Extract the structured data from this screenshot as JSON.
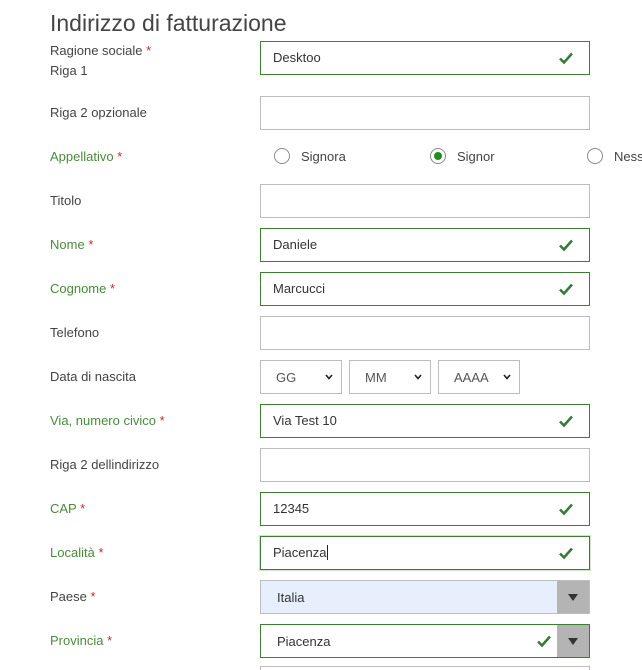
{
  "form": {
    "title": "Indirizzo di fatturazione",
    "required_mark": "*",
    "company": {
      "label": "Ragione sociale",
      "sublabel": "Riga 1",
      "value": "Desktoo"
    },
    "line2_optional": {
      "label": "Riga 2 opzionale",
      "value": ""
    },
    "salutation": {
      "label": "Appellativo",
      "options": [
        {
          "label": "Signora",
          "selected": false
        },
        {
          "label": "Signor",
          "selected": true
        },
        {
          "label": "Nessuno",
          "selected": false
        }
      ]
    },
    "title_field": {
      "label": "Titolo",
      "value": ""
    },
    "first_name": {
      "label": "Nome",
      "value": "Daniele"
    },
    "last_name": {
      "label": "Cognome",
      "value": "Marcucci"
    },
    "phone": {
      "label": "Telefono",
      "value": ""
    },
    "birthdate": {
      "label": "Data di nascita",
      "day": "GG",
      "month": "MM",
      "year": "AAAA"
    },
    "street": {
      "label": "Via, numero civico",
      "value": "Via Test 10"
    },
    "address_line2": {
      "label": "Riga 2 dellindirizzo",
      "value": ""
    },
    "zip": {
      "label": "CAP",
      "value": "12345"
    },
    "city": {
      "label": "Località",
      "value": "Piacenza"
    },
    "country": {
      "label": "Paese",
      "value": "Italia"
    },
    "province": {
      "label": "Provincia",
      "value": "Piacenza"
    }
  },
  "colors": {
    "valid_border": "#3c7f33",
    "valid_label": "#4a8a3c",
    "required_asterisk": "#cc2b2b",
    "checkmark": "#3a7a3a",
    "radio_selected": "#1e8f1e",
    "country_select_bg": "#e8effc",
    "dropdown_button": "#b4b4b4"
  },
  "icons": {
    "valid": "check-icon",
    "dropdown": "caret-down-icon"
  }
}
